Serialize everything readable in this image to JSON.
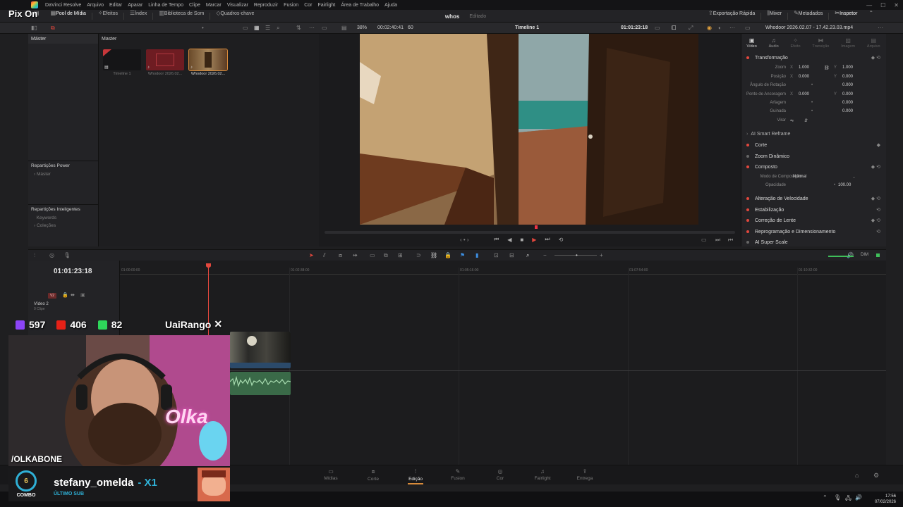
{
  "menubar": {
    "items": [
      "DaVinci Resolve",
      "Arquivo",
      "Editar",
      "Aparar",
      "Linha de Tempo",
      "Clipe",
      "Marcar",
      "Visualizar",
      "Reproduzir",
      "Fusion",
      "Cor",
      "Fairlight",
      "Área de Trabalho",
      "Ajuda"
    ]
  },
  "toolbar": {
    "left": [
      "Pool de Mídia",
      "Efeitos",
      "Índex",
      "Biblioteca de Som",
      "Quadros-chave"
    ],
    "right": [
      "Exportação Rápida",
      "Mixer",
      "Metadados",
      "Inspetor"
    ],
    "project_name": "whos",
    "project_status": "Editado"
  },
  "subbar": {
    "zoom": "38%",
    "timecode_in": "00:02:40:41",
    "fps": "60",
    "timeline_name": "Timeline 1",
    "timecode_out": "01:01:23:18",
    "clip_name": "Whodoor 2026.02.07 - 17.42.23.03.mp4"
  },
  "media_pool": {
    "bin_header": "Máster",
    "clips_header": "Master",
    "power_bins_title": "Repartições Power",
    "power_bins_item": "Máster",
    "smart_bins_title": "Repartições Inteligentes",
    "smart_bins_items": [
      "Keywords",
      "Coleções"
    ],
    "clips": [
      {
        "label": "Timeline 1"
      },
      {
        "label": "Whodoor 2026.02..."
      },
      {
        "label": "Whodoor 2026.02..."
      }
    ]
  },
  "inspector": {
    "tabs": [
      "Vídeo",
      "Áudio",
      "Efeito",
      "Transição",
      "Imagem",
      "Arquivo"
    ],
    "sections": {
      "transform": "Transformação",
      "smart_reframe": "AI Smart Reframe",
      "crop": "Corte",
      "dynamic_zoom": "Zoom Dinâmico",
      "composite": "Composto",
      "speed": "Alteração de Velocidade",
      "stabilization": "Estabilização",
      "lens": "Correção de Lente",
      "retime": "Reprogramação e Dimensionamento",
      "super_scale": "AI Super Scale"
    },
    "props": {
      "zoom_label": "Zoom",
      "zoom_x": "1.000",
      "zoom_y": "1.000",
      "pos_label": "Posição",
      "pos_x": "0.000",
      "pos_y": "0.000",
      "rot_label": "Ângulo de Rotação",
      "rot": "0.000",
      "anchor_label": "Ponto de Ancoragem",
      "anchor_x": "0.000",
      "anchor_y": "0.000",
      "pitch_label": "Arfagem",
      "pitch": "0.000",
      "yaw_label": "Guinada",
      "yaw": "0.000",
      "flip_label": "Virar",
      "comp_mode_label": "Modo de Composição",
      "comp_mode": "Normal",
      "opacity_label": "Opacidade",
      "opacity": "100.00"
    }
  },
  "timeline": {
    "timecode": "01:01:23:18",
    "ruler": [
      "01:00:00:00",
      "01:02:38:00",
      "01:05:16:00",
      "01:07:54:00",
      "01:10:32:00"
    ],
    "track_badge": "V2",
    "track_name": "Vídeo 2",
    "track_clips": "0 Clipe"
  },
  "pages": [
    "Mídias",
    "Corte",
    "Edição",
    "Fusion",
    "Cor",
    "Fairlight",
    "Entrega"
  ],
  "audio_meter_label": "DIM",
  "overlay": {
    "title": "Pix On",
    "twitch_count": "597",
    "youtube_count": "406",
    "kick_count": "82",
    "brand": "UaiRango",
    "handle": "/OLKABONE",
    "combo_count": "6",
    "combo_label": "COMBO",
    "sub_name": "stefany_omelda",
    "sub_mult": "- X1",
    "sub_caption": "ÚLTIMO SUB",
    "neon_sign": "Olka"
  },
  "clock": {
    "time": "17:56",
    "date": "07/02/2026"
  }
}
